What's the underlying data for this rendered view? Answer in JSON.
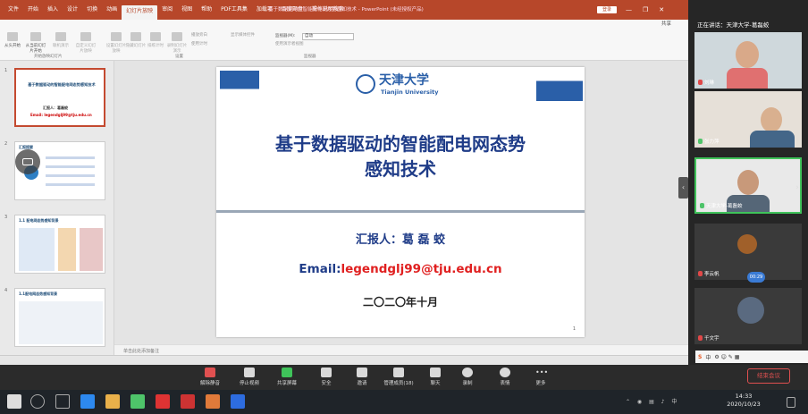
{
  "ppt": {
    "menu": [
      "文件",
      "开始",
      "插入",
      "设计",
      "切换",
      "动画",
      "幻灯片放映",
      "审阅",
      "视图",
      "帮助",
      "PDF工具集",
      "加载项",
      "百度网盘",
      "操作说明搜索"
    ],
    "active_tab": "幻灯片放映",
    "doc_title": "基于数据驱动的智能配电网态势感知技术 - PowerPoint (未经授权产品)",
    "login": "登录",
    "share": "共享",
    "ribbon_buttons": [
      "从头开始",
      "从当前幻灯片开始",
      "联机演示",
      "自定义幻灯片放映",
      "设置幻灯片放映",
      "隐藏幻灯片",
      "排练计时",
      "录制幻灯片演示"
    ],
    "ribbon_groups": [
      "开始放映幻灯片",
      "设置",
      "监视器"
    ],
    "ribbon_checks": [
      "播放旁白",
      "使用计时",
      "显示媒体控件",
      "使用演示者视图"
    ],
    "monitor_label": "监视器(M):",
    "monitor_value": "自动",
    "notes_placeholder": "单击此处添加备注",
    "thumb_numbers": [
      "1",
      "2",
      "3",
      "4"
    ]
  },
  "slide": {
    "logo_cn": "天津大学",
    "logo_en": "Tianjin University",
    "title_line1": "基于数据驱动的智能配电网态势",
    "title_line2": "感知技术",
    "reporter_label": "汇报人：",
    "reporter_name": "葛 磊 蛟",
    "email_label": "Email:",
    "email": "legendglj99@tju.edu.cn",
    "date": "二〇二〇年十月",
    "number": "1"
  },
  "thumbs": {
    "t1_title": "基于数据驱动的智能配电网态势感知技术",
    "t1_reporter": "汇报人：葛磊蛟",
    "t1_email": "Email: legendglj99@tju.edu.cn",
    "t2_title": "汇报提要",
    "t3_title": "1.1 配电网态势感知背景",
    "t4_title": "1.1配电网态势感知背景"
  },
  "panel": {
    "title": "正在讲话：天津大学-葛磊蛟",
    "participants": [
      {
        "name": "刘琳",
        "muted": true
      },
      {
        "name": "张力萍",
        "muted": false
      },
      {
        "name": "天津大学-葛磊蛟",
        "muted": false
      },
      {
        "name": "李云帆",
        "muted": true
      },
      {
        "name": "千文宇",
        "muted": true
      }
    ],
    "speaking_badge": "00:29"
  },
  "ime": {
    "logo": "S",
    "mode": "中"
  },
  "toolbar": {
    "items": [
      "解除静音",
      "停止视频",
      "共享屏幕",
      "安全",
      "邀请",
      "管理成员(18)",
      "聊天",
      "录制",
      "表情",
      "更多"
    ],
    "end": "结束会议"
  },
  "taskbar": {
    "time": "14:33",
    "date": "2020/10/23"
  },
  "colors": {
    "ppt_accent": "#b7472a",
    "slide_title": "#1f3c88",
    "email_red": "#e02020",
    "end_red": "#e05050"
  }
}
